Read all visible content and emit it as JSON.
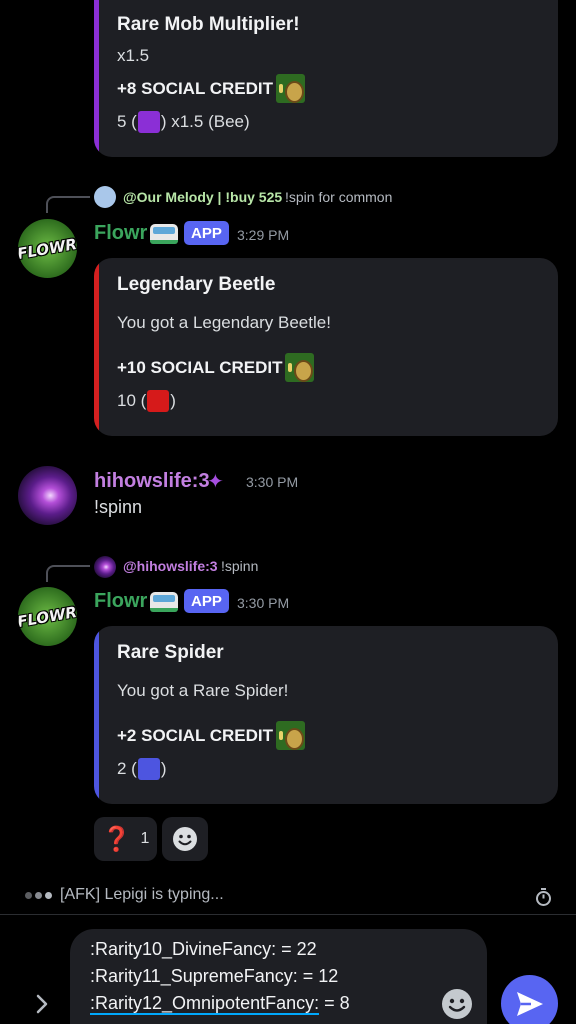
{
  "messages": [
    {
      "embed": {
        "title": "Rare Mob Multiplier!",
        "text": "x1.5",
        "credit": "+8 SOCIAL CREDIT",
        "count_prefix": "5 (",
        "count_suffix": ") x1.5 (Bee)",
        "accent": "#8b2fd6",
        "square_color": "#8b2fd6"
      }
    },
    {
      "reply": {
        "name": "@Our Melody | !buy 525",
        "text": "!spin for common",
        "name_color": "#b8e6a8"
      },
      "author": "Flowr",
      "author_color": "#3ba55d",
      "badge": "APP",
      "time": "3:29 PM",
      "embed": {
        "title": "Legendary Beetle",
        "text": "You got a Legendary Beetle!",
        "credit": "+10 SOCIAL CREDIT",
        "count_prefix": "10 (",
        "count_suffix": ")",
        "accent": "#d42020",
        "square_color": "#d61a1a"
      }
    },
    {
      "author": "hihowslife:3",
      "author_color": "#c27fe0",
      "time": "3:30 PM",
      "content": "!spinn"
    },
    {
      "reply": {
        "name": "@hihowslife:3",
        "text": "!spinn",
        "name_color": "#c27fe0"
      },
      "author": "Flowr",
      "author_color": "#3ba55d",
      "badge": "APP",
      "time": "3:30 PM",
      "embed": {
        "title": "Rare Spider",
        "text": "You got a Rare Spider!",
        "credit": "+2 SOCIAL CREDIT",
        "count_prefix": "2 (",
        "count_suffix": ")",
        "accent": "#4d55e0",
        "square_color": "#4d55e0"
      }
    }
  ],
  "reactions": [
    {
      "emoji": "❓",
      "count": "1"
    },
    {
      "emoji": "add-reaction-icon"
    }
  ],
  "typing": {
    "text": "[AFK] Lepigi is typing..."
  },
  "composer": {
    "lines": [
      {
        "code": ":Rarity10_DivineFancy:",
        "rest": " = 22"
      },
      {
        "code": ":Rarity11_SupremeFancy:",
        "rest": " = 12"
      },
      {
        "code": ":Rarity12_OmnipotentFancy:",
        "rest": " = 8"
      }
    ]
  },
  "icons": {
    "expand": "chevron-right-icon",
    "emoji": "emoji-icon",
    "send": "send-icon",
    "timer": "stopwatch-icon"
  }
}
